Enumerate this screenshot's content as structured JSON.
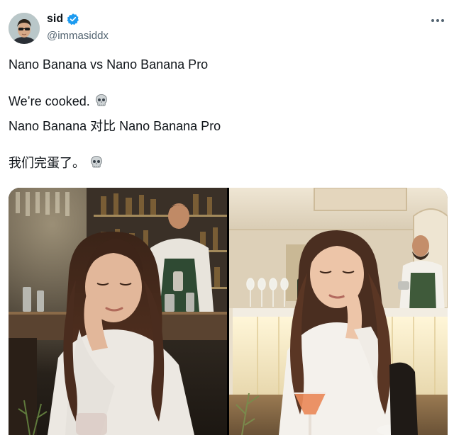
{
  "author": {
    "display_name": "sid",
    "handle": "@immasiddx",
    "verified": true,
    "avatar_icon": "profile-avatar"
  },
  "more_icon": "more-horizontal-icon",
  "post_lines": [
    "Nano Banana vs Nano Banana Pro",
    "We’re cooked.",
    "Nano Banana 对比 Nano Banana Pro",
    "我们完蛋了。"
  ],
  "emoji_icon": "skull-icon",
  "colors": {
    "verified_blue": "#1d9bf0",
    "text_primary": "#0f1419",
    "text_secondary": "#536471"
  },
  "media": [
    {
      "name": "photo-nano-banana",
      "description_icon": "photo"
    },
    {
      "name": "photo-nano-banana-pro",
      "description_icon": "photo"
    }
  ]
}
